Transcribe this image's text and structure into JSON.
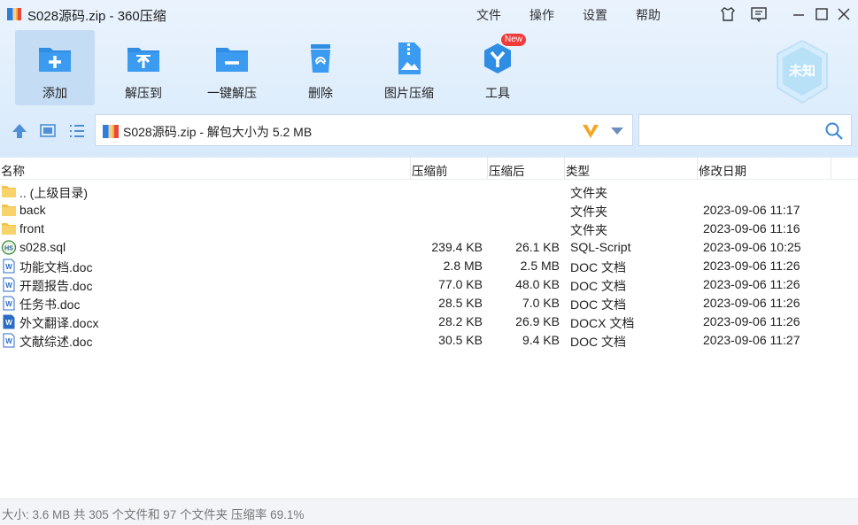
{
  "window": {
    "title": "S028源码.zip - 360压缩"
  },
  "menu": [
    "文件",
    "操作",
    "设置",
    "帮助"
  ],
  "toolbar": {
    "add": "添加",
    "extract_to": "解压到",
    "one_click_extract": "一键解压",
    "delete": "删除",
    "image_compress": "图片压缩",
    "tools": "工具",
    "tools_badge": "New"
  },
  "security_badge": "未知",
  "address": {
    "path": "S028源码.zip - 解包大小为 5.2 MB"
  },
  "search": {
    "placeholder": ""
  },
  "columns": {
    "name": "名称",
    "packed": "压缩前",
    "compressed": "压缩后",
    "type": "类型",
    "modified": "修改日期"
  },
  "files": [
    {
      "name": ".. (上级目录)",
      "packed": "",
      "compressed": "",
      "type": "文件夹",
      "modified": "",
      "icon": "folder-icon"
    },
    {
      "name": "back",
      "packed": "",
      "compressed": "",
      "type": "文件夹",
      "modified": "2023-09-06 11:17",
      "icon": "folder-icon"
    },
    {
      "name": "front",
      "packed": "",
      "compressed": "",
      "type": "文件夹",
      "modified": "2023-09-06 11:16",
      "icon": "folder-icon"
    },
    {
      "name": "s028.sql",
      "packed": "239.4 KB",
      "compressed": "26.1 KB",
      "type": "SQL-Script",
      "modified": "2023-09-06 10:25",
      "icon": "sql-file-icon"
    },
    {
      "name": "功能文档.doc",
      "packed": "2.8 MB",
      "compressed": "2.5 MB",
      "type": "DOC 文档",
      "modified": "2023-09-06 11:26",
      "icon": "word-doc-icon"
    },
    {
      "name": "开题报告.doc",
      "packed": "77.0 KB",
      "compressed": "48.0 KB",
      "type": "DOC 文档",
      "modified": "2023-09-06 11:26",
      "icon": "word-doc-icon"
    },
    {
      "name": "任务书.doc",
      "packed": "28.5 KB",
      "compressed": "7.0 KB",
      "type": "DOC 文档",
      "modified": "2023-09-06 11:26",
      "icon": "word-doc-icon"
    },
    {
      "name": "外文翻译.docx",
      "packed": "28.2 KB",
      "compressed": "26.9 KB",
      "type": "DOCX 文档",
      "modified": "2023-09-06 11:26",
      "icon": "word-docx-icon"
    },
    {
      "name": "文献综述.doc",
      "packed": "30.5 KB",
      "compressed": "9.4 KB",
      "type": "DOC 文档",
      "modified": "2023-09-06 11:27",
      "icon": "word-doc-icon"
    }
  ],
  "status": {
    "text": "大小: 3.6 MB 共 305 个文件和 97 个文件夹 压缩率 69.1%"
  },
  "colors": {
    "accent": "#2f8de4",
    "toolbar_bg": "#dfeefc",
    "selected_tool": "#c5dcf5"
  }
}
